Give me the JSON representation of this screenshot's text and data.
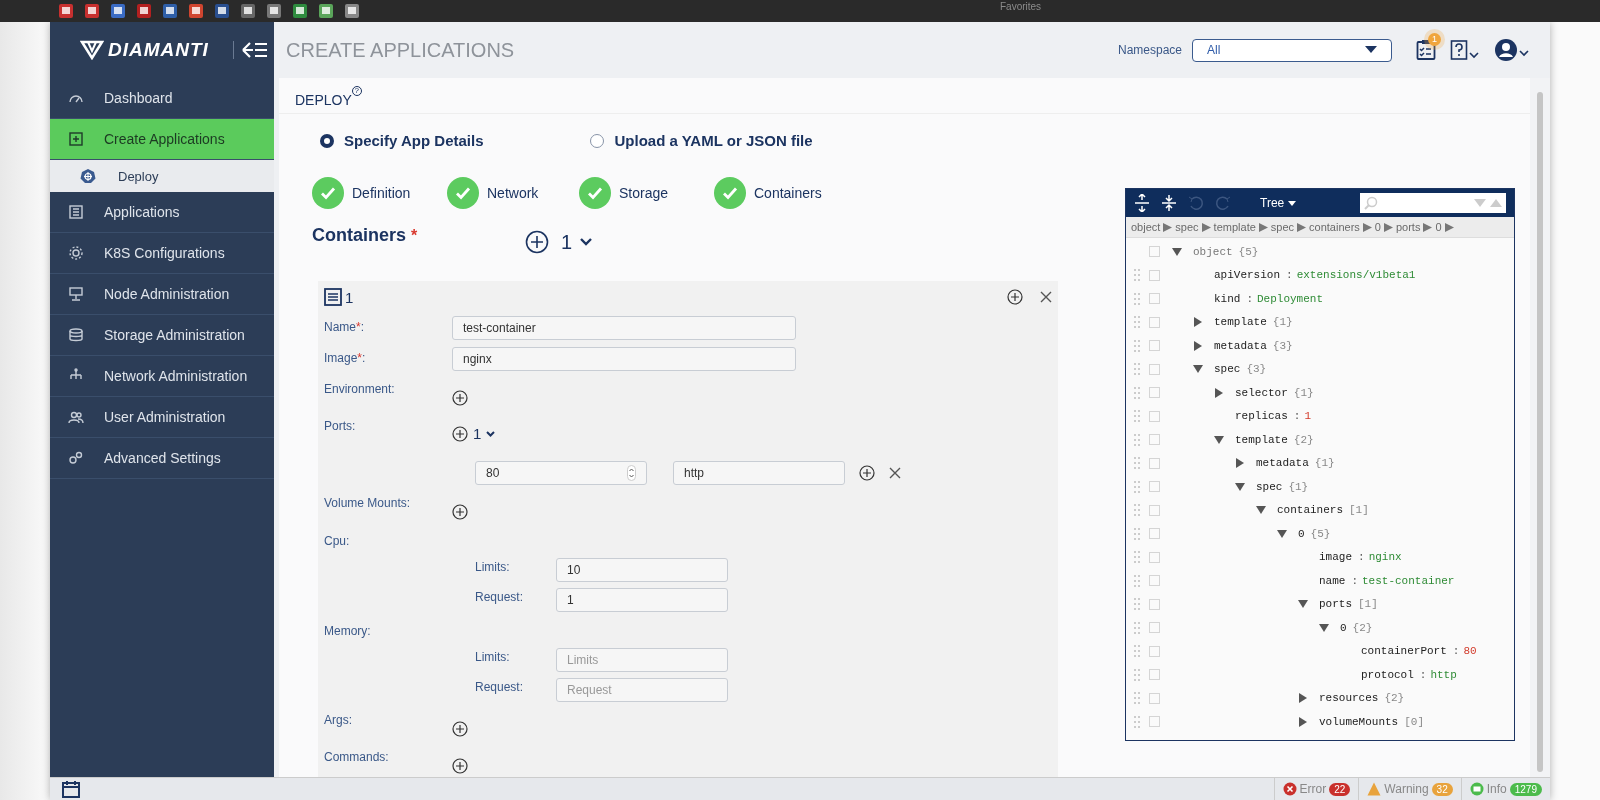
{
  "browser": {
    "favorites_label": "Favorites"
  },
  "sidebar": {
    "logo": "DIAMANTI",
    "items": [
      {
        "label": "Dashboard",
        "selected": false
      },
      {
        "label": "Create Applications",
        "selected": true,
        "children": [
          {
            "label": "Deploy",
            "selected": true
          }
        ]
      },
      {
        "label": "Applications",
        "selected": false
      },
      {
        "label": "K8S Configurations",
        "selected": false
      },
      {
        "label": "Node Administration",
        "selected": false
      },
      {
        "label": "Storage Administration",
        "selected": false
      },
      {
        "label": "Network Administration",
        "selected": false
      },
      {
        "label": "User Administration",
        "selected": false
      },
      {
        "label": "Advanced Settings",
        "selected": false
      }
    ]
  },
  "header": {
    "title": "CREATE APPLICATIONS",
    "namespace_label": "Namespace",
    "namespace_value": "All",
    "notification_badge": "1"
  },
  "card": {
    "title": "DEPLOY",
    "help_mark": "?"
  },
  "modes": [
    {
      "label": "Specify App Details",
      "selected": true
    },
    {
      "label": "Upload a YAML or JSON file",
      "selected": false
    }
  ],
  "steps": [
    {
      "label": "Definition",
      "done": true
    },
    {
      "label": "Network",
      "done": true
    },
    {
      "label": "Storage",
      "done": true
    },
    {
      "label": "Containers",
      "done": true
    }
  ],
  "containers": {
    "title": "Containers",
    "mark": "*",
    "count": "1"
  },
  "container": {
    "header": "1",
    "fields": [
      {
        "kind": "text",
        "label": "Name",
        "mark": "*",
        "suffix": ":",
        "value": "test-container"
      },
      {
        "kind": "text",
        "label": "Image",
        "mark": "*",
        "suffix": ":",
        "value": "nginx"
      },
      {
        "kind": "add",
        "label": "Environment:"
      },
      {
        "kind": "count",
        "label": "Ports:",
        "count": "1"
      },
      {
        "kind": "port",
        "port": "80",
        "protocol": "http"
      },
      {
        "kind": "add",
        "label": "Volume Mounts:"
      },
      {
        "kind": "limits",
        "label": "Cpu:",
        "rows": [
          {
            "label": "Limits:",
            "value": "10"
          },
          {
            "label": "Request:",
            "value": "1"
          }
        ]
      },
      {
        "kind": "limits",
        "label": "Memory:",
        "rows": [
          {
            "label": "Limits:",
            "placeholder": "Limits"
          },
          {
            "label": "Request:",
            "placeholder": "Request"
          }
        ]
      },
      {
        "kind": "add",
        "label": "Args:"
      },
      {
        "kind": "add",
        "label": "Commands:"
      }
    ]
  },
  "editor": {
    "mode": "Tree",
    "breadcrumb": [
      "object",
      "spec",
      "template",
      "spec",
      "containers",
      "0",
      "ports",
      "0"
    ],
    "tree": [
      {
        "key": "object",
        "count": "{5}",
        "expanded": true,
        "children": [
          {
            "key": "apiVersion",
            "sep": ":",
            "value": "extensions/v1beta1",
            "kind": "string"
          },
          {
            "key": "kind",
            "sep": ":",
            "value": "Deployment",
            "kind": "string"
          },
          {
            "key": "template",
            "count": "{1}",
            "expanded": false
          },
          {
            "key": "metadata",
            "count": "{3}",
            "expanded": false
          },
          {
            "key": "spec",
            "count": "{3}",
            "expanded": true,
            "children": [
              {
                "key": "selector",
                "count": "{1}",
                "expanded": false
              },
              {
                "key": "replicas",
                "sep": ":",
                "value": "1",
                "kind": "number"
              },
              {
                "key": "template",
                "count": "{2}",
                "expanded": true,
                "children": [
                  {
                    "key": "metadata",
                    "count": "{1}",
                    "expanded": false
                  },
                  {
                    "key": "spec",
                    "count": "{1}",
                    "expanded": true,
                    "children": [
                      {
                        "key": "containers",
                        "count": "[1]",
                        "expanded": true,
                        "children": [
                          {
                            "key": "0",
                            "count": "{5}",
                            "expanded": true,
                            "children": [
                              {
                                "key": "image",
                                "sep": ":",
                                "value": "nginx",
                                "kind": "string"
                              },
                              {
                                "key": "name",
                                "sep": ":",
                                "value": "test-container",
                                "kind": "string"
                              },
                              {
                                "key": "ports",
                                "count": "[1]",
                                "expanded": true,
                                "children": [
                                  {
                                    "key": "0",
                                    "count": "{2}",
                                    "expanded": true,
                                    "children": [
                                      {
                                        "key": "containerPort",
                                        "sep": ":",
                                        "value": "80",
                                        "kind": "number"
                                      },
                                      {
                                        "key": "protocol",
                                        "sep": ":",
                                        "value": "http",
                                        "kind": "string"
                                      }
                                    ]
                                  }
                                ]
                              },
                              {
                                "key": "resources",
                                "count": "{2}",
                                "expanded": false
                              },
                              {
                                "key": "volumeMounts",
                                "count": "[0]",
                                "expanded": false
                              }
                            ]
                          }
                        ]
                      }
                    ]
                  }
                ]
              }
            ]
          }
        ]
      }
    ]
  },
  "status_bar": [
    {
      "label": "Error",
      "count": "22",
      "color": "#c9302c"
    },
    {
      "label": "Warning",
      "count": "32",
      "color": "#e8a33d"
    },
    {
      "label": "Info",
      "count": "1279",
      "color": "#4cbb4c"
    }
  ]
}
